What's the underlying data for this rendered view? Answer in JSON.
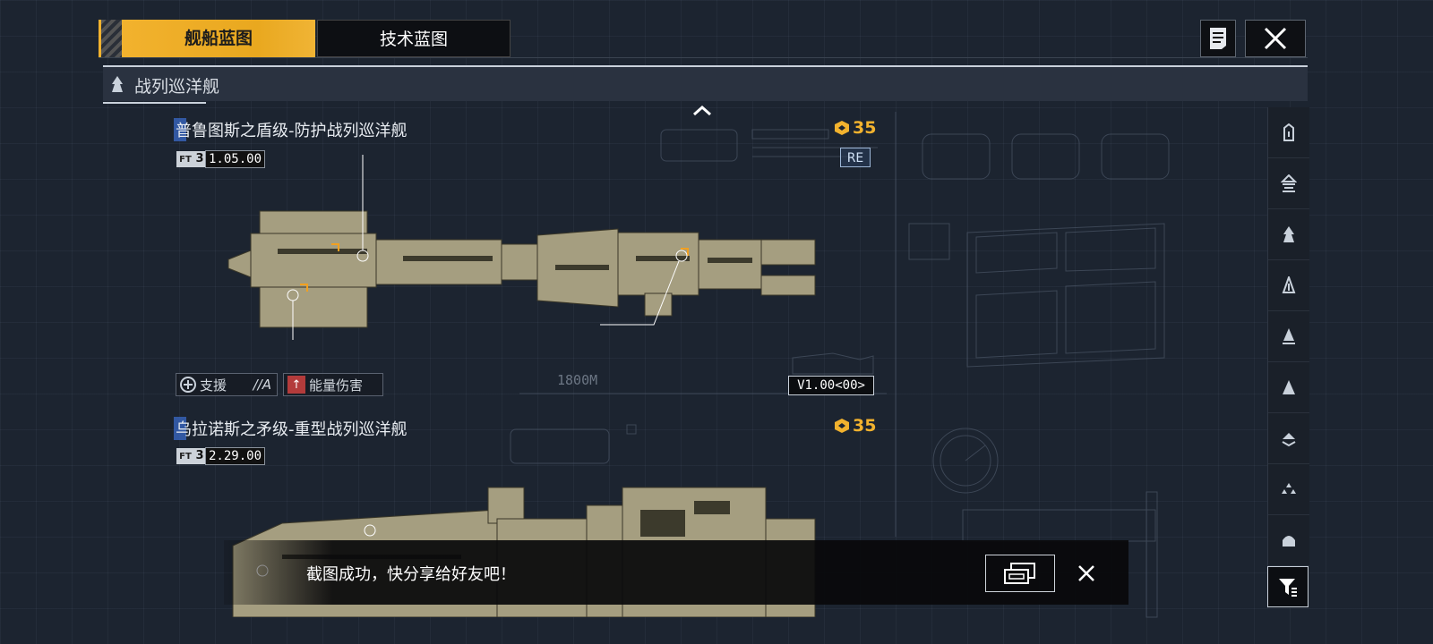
{
  "tabs": [
    {
      "label": "舰船蓝图",
      "active": true
    },
    {
      "label": "技术蓝图",
      "active": false
    }
  ],
  "category": {
    "title": "战列巡洋舰"
  },
  "ships": [
    {
      "name": "普鲁图斯之盾级-防护战列巡洋舰",
      "tier": "3",
      "version_number": "1.05.00",
      "cost": "35",
      "badge": "RE",
      "role": "支援",
      "role_grade": "//A",
      "damage_type": "能量伤害",
      "length": "1800M",
      "blueprint_version": "V1.00<00>"
    },
    {
      "name": "乌拉诺斯之矛级-重型战列巡洋舰",
      "tier": "3",
      "version_number": "2.29.00",
      "cost": "35"
    }
  ],
  "sidebar": {
    "items": [
      "frigate-icon",
      "destroyer-icon",
      "cruiser-icon",
      "battlecruiser-icon",
      "auxiliary-icon",
      "carrier-icon",
      "battleship-icon",
      "squadron-icon",
      "base-icon"
    ]
  },
  "toast": {
    "message": "截图成功，快分享给好友吧！"
  },
  "colors": {
    "accent": "#f2b22e",
    "background": "#1c2430",
    "toast_bg": "#08080a",
    "ship_hull": "#a9a183"
  }
}
